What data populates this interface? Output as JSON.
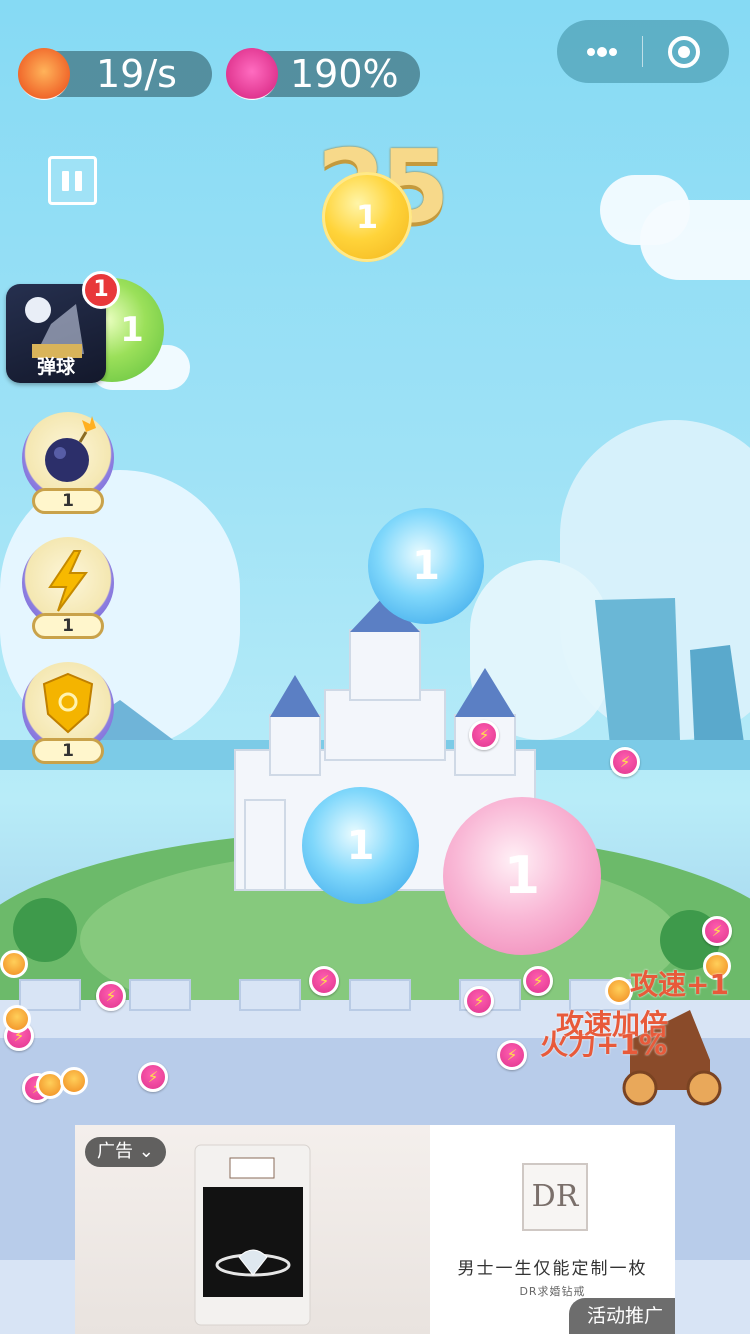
{
  "hud": {
    "speed": {
      "icon": "speedometer-icon",
      "value": "19/s"
    },
    "power": {
      "icon": "lightning-icon",
      "value": "190%"
    }
  },
  "capsule": {
    "more_icon": "more-dots-icon",
    "close_icon": "target-close-icon"
  },
  "score": "25",
  "side_app": {
    "label": "弹球",
    "badge": "1"
  },
  "powerups": [
    {
      "icon": "bomb-icon",
      "count": "1"
    },
    {
      "icon": "lightning-icon",
      "count": "1"
    },
    {
      "icon": "shield-icon",
      "count": "1"
    }
  ],
  "balls": [
    {
      "number": "1",
      "color": "yellow"
    },
    {
      "number": "1",
      "color": "green"
    },
    {
      "number": "1",
      "color": "blue"
    },
    {
      "number": "1",
      "color": "blue"
    },
    {
      "number": "1",
      "color": "pink"
    }
  ],
  "floating_texts": [
    "攻速+1",
    "攻速加倍",
    "火力+1%"
  ],
  "ad": {
    "tag": "广告",
    "logo": "DR",
    "headline": "男士一生仅能定制一枚",
    "subline": "DR求婚钻戒",
    "promo": "活动推广"
  },
  "colors": {
    "sky": "#8fdcf5",
    "coin": "#e0358f",
    "score": "#f7d98a"
  }
}
